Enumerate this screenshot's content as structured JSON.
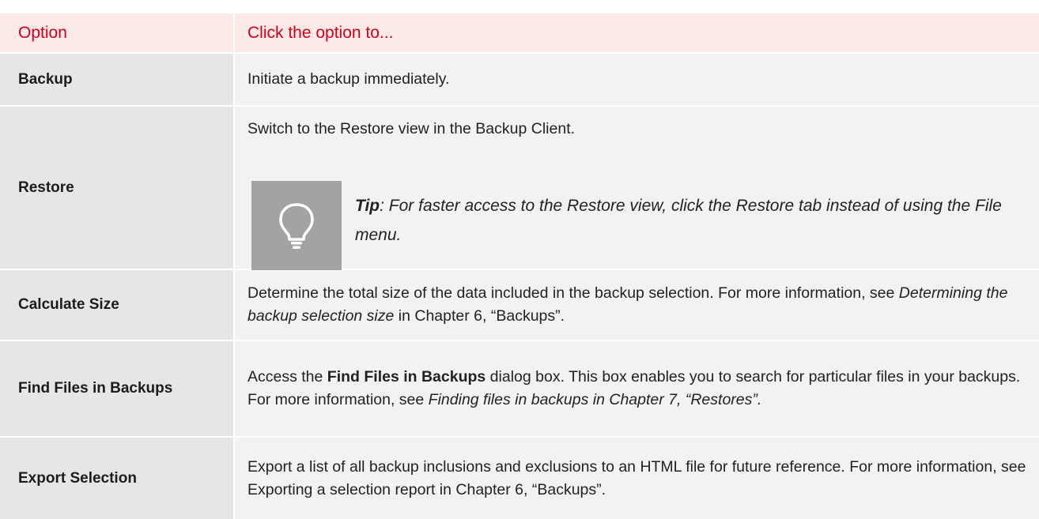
{
  "header": {
    "col1": "Option",
    "col2": "Click the option to..."
  },
  "rows": [
    {
      "option": "Backup",
      "desc": "Initiate a backup immediately."
    },
    {
      "option": "Restore",
      "desc": "Switch to the Restore view in the Backup Client.",
      "tip_label": "Tip",
      "tip_text": ": For faster access to the Restore view, click the Restore tab instead of using the File menu.",
      "tip_icon": "lightbulb-icon"
    },
    {
      "option": "Calculate Size",
      "desc_a": "Determine the total size of the data included in the backup selection. For more information, see ",
      "desc_em": "Determining the backup selection size",
      "desc_b": " in Chapter 6, “Backups”."
    },
    {
      "option": "Find Files in Backups",
      "desc_a": "Access the ",
      "desc_strong": "Find Files in Backups",
      "desc_b": " dialog box. This box enables you to search for particular files in your backups. For more information, see ",
      "desc_em": "Finding files in backups in Chapter 7, “Restores”."
    },
    {
      "option": "Export Selection",
      "desc": "Export a list of all backup inclusions and exclusions to an HTML file for future reference. For more information, see Exporting a selection report in Chapter 6, “Backups”."
    }
  ],
  "colors": {
    "header_bg": "#fbe9e7",
    "header_text": "#d0021b",
    "col1_bg": "#e6e6e6",
    "col2_bg": "#f2f2f2",
    "tip_bg": "#a3a3a3"
  }
}
